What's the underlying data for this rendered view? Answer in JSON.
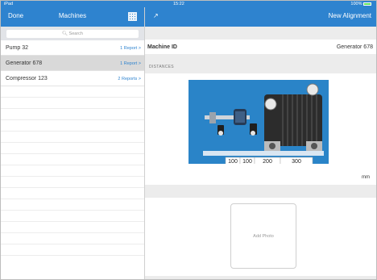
{
  "status": {
    "carrier": "iPad",
    "time": "15:22",
    "battery": "100%"
  },
  "left": {
    "done": "Done",
    "title": "Machines",
    "search_placeholder": "Search",
    "machines": [
      {
        "name": "Pump 32",
        "reports": "1 Report"
      },
      {
        "name": "Generator 678",
        "reports": "1 Report"
      },
      {
        "name": "Compressor 123",
        "reports": "2 Reports"
      }
    ]
  },
  "right": {
    "new_alignment": "New Alignment",
    "machine_id_label": "Machine ID",
    "machine_id_value": "Generator 678",
    "distances_label": "DISTANCES",
    "distances": [
      "100",
      "100",
      "200",
      "300"
    ],
    "unit": "mm",
    "add_photo": "Add Photo"
  },
  "colors": {
    "accent": "#2e83cf",
    "diagram_bg": "#2a84c8",
    "selected_row": "#d9d9d9"
  },
  "icons": {
    "expand": "expand-icon",
    "qr": "qr-code-icon",
    "search": "search-icon",
    "chevron": "chevron-right-icon"
  }
}
